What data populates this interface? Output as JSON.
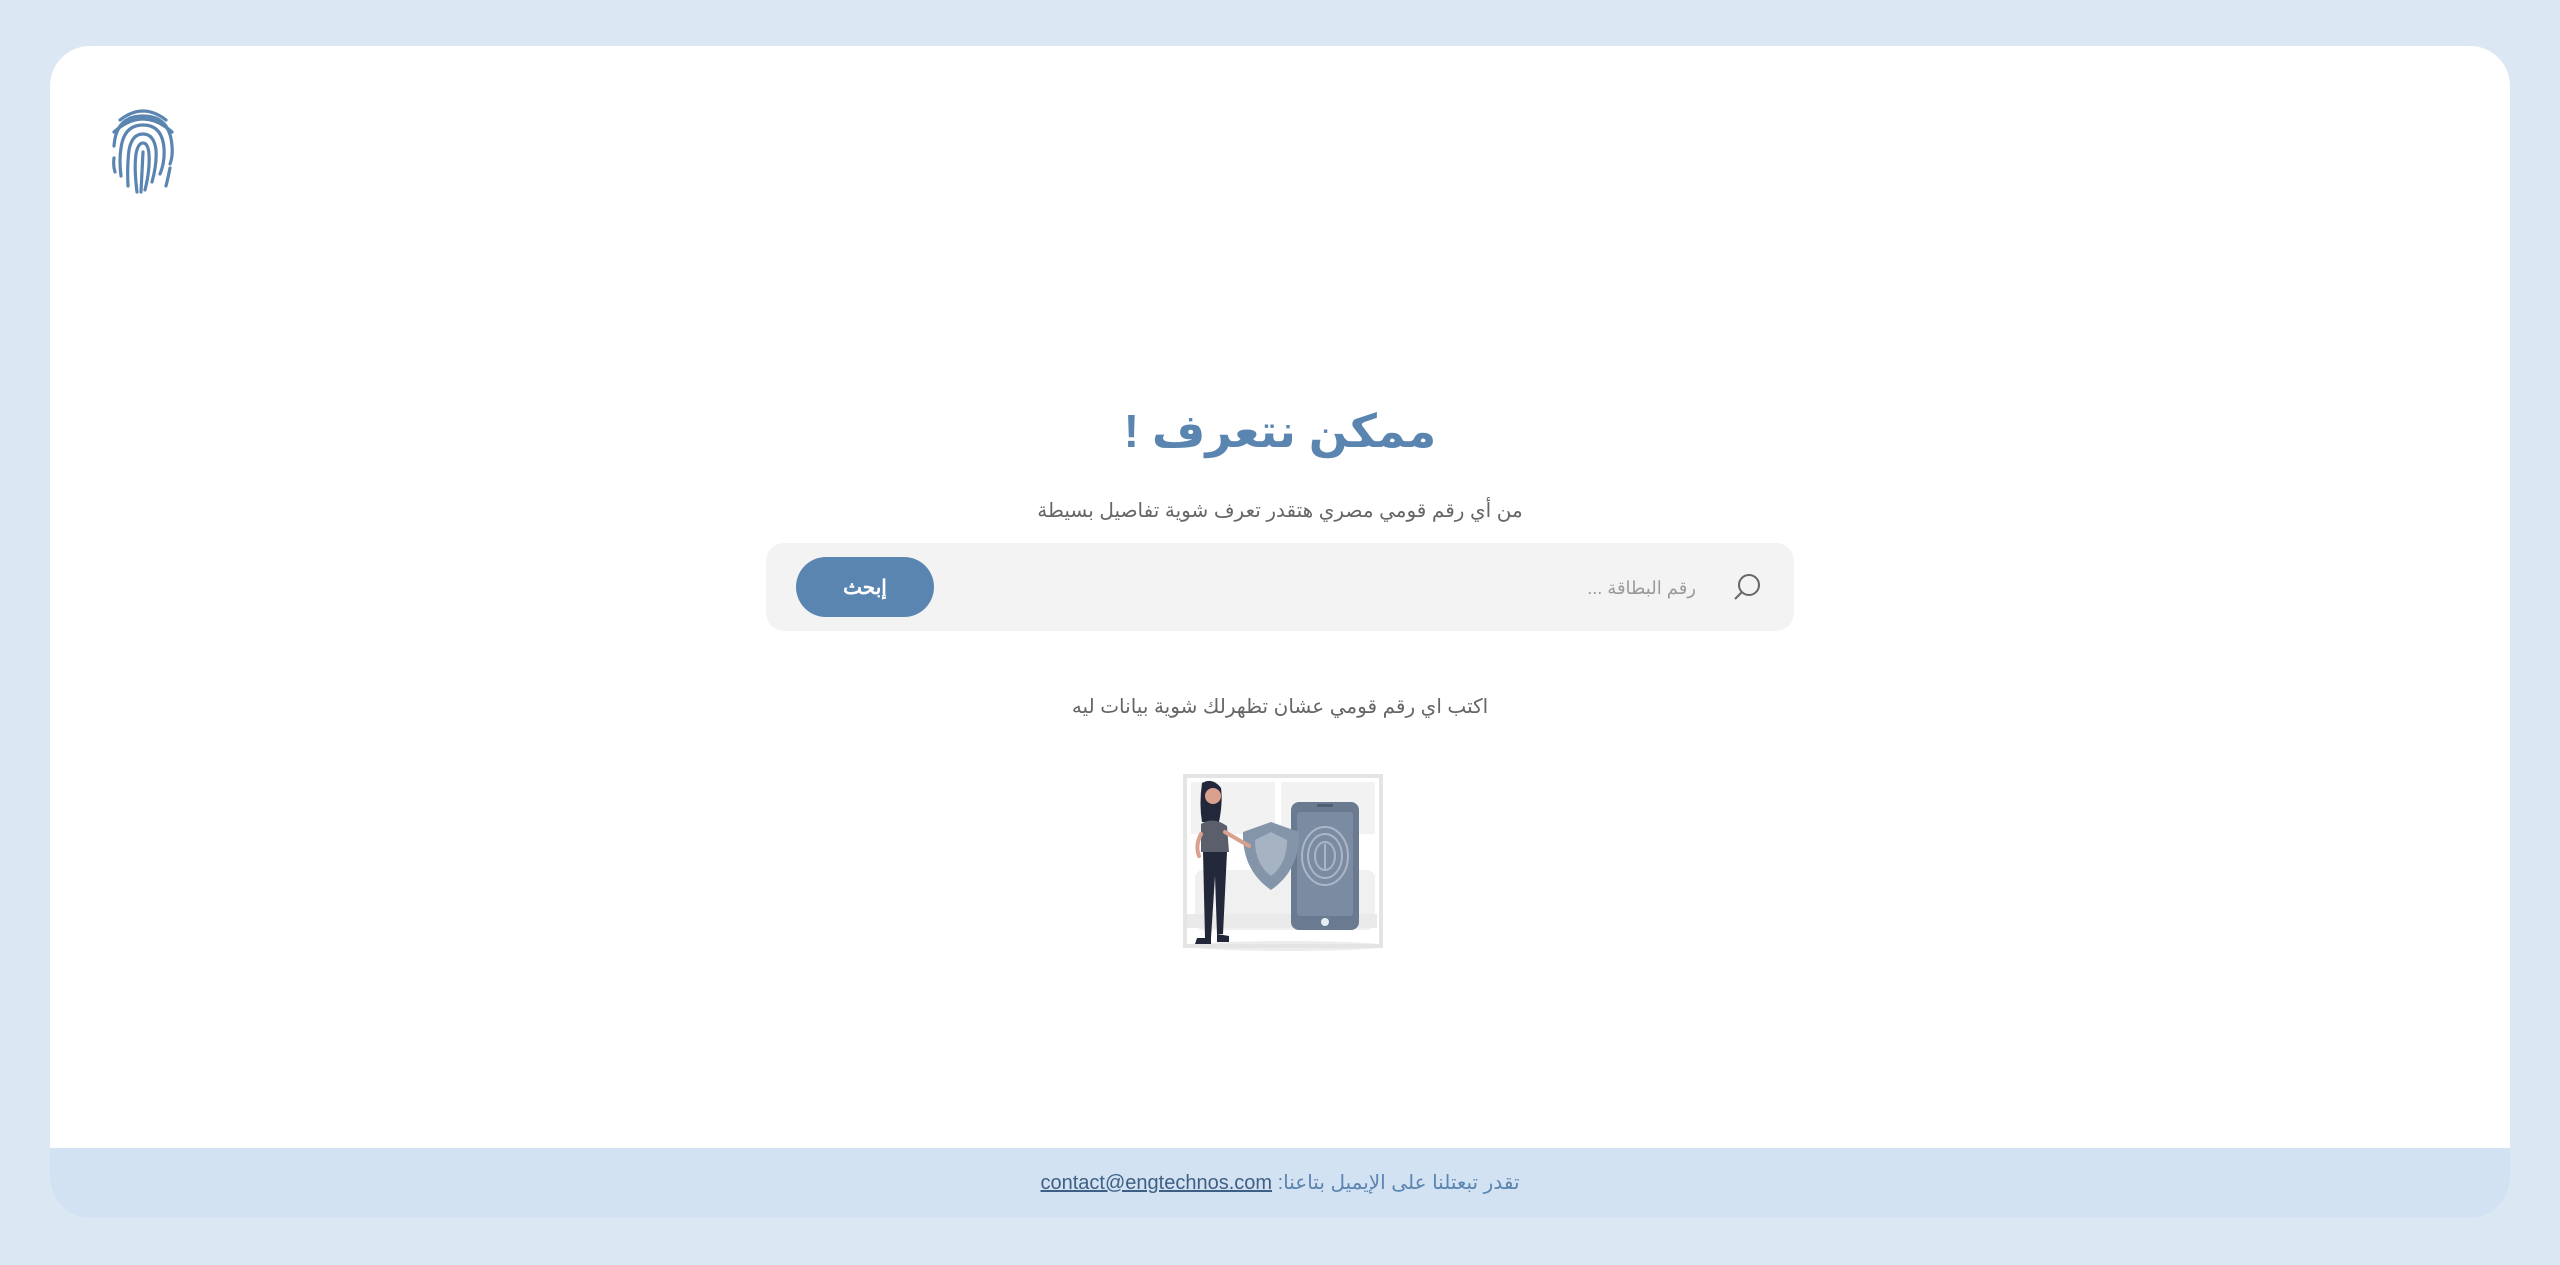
{
  "header": {
    "logo_icon": "fingerprint-icon"
  },
  "hero": {
    "title": "ممكن نتعرف !",
    "subtitle": "من أي رقم قومي مصري هتقدر تعرف شوية تفاصيل بسيطة"
  },
  "search": {
    "icon": "search-icon",
    "placeholder": "رقم البطاقة ...",
    "value": "",
    "button_label": "إبحث"
  },
  "hint": {
    "text": "اكتب اي رقم قومي عشان تظهرلك شوية بيانات ليه"
  },
  "illustration": {
    "icon": "security-fingerprint-illustration"
  },
  "footer": {
    "text": "تقدر تبعتلنا على الإيميل بتاعنا:",
    "email": "contact@engtechnos.com"
  },
  "colors": {
    "accent": "#5b85b1",
    "page_background": "#dbe7f3",
    "footer_background": "#d2e2f2",
    "search_background": "#f3f3f3"
  }
}
